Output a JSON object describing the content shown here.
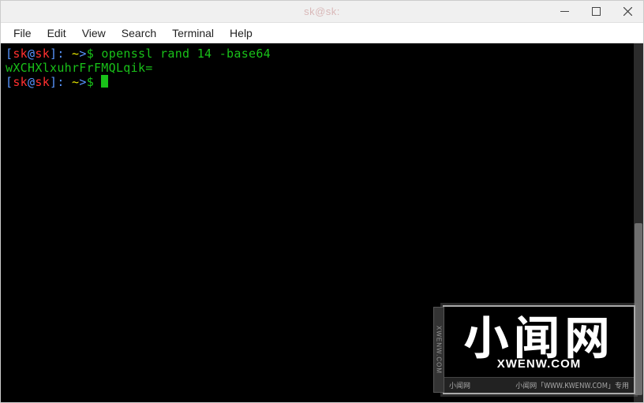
{
  "window": {
    "title": "sk@sk:"
  },
  "menubar": {
    "items": [
      "File",
      "Edit",
      "View",
      "Search",
      "Terminal",
      "Help"
    ]
  },
  "terminal": {
    "lines": [
      {
        "prompt": {
          "open": "[",
          "user": "sk",
          "at": "@",
          "host": "sk",
          "close": "]",
          "colon": ": ",
          "path": "~",
          "arrow": ">",
          "dollar": "$ "
        },
        "command": "openssl rand 14 -base64"
      },
      {
        "output": "wXCHXlxuhrFrFMQLqik="
      },
      {
        "prompt": {
          "open": "[",
          "user": "sk",
          "at": "@",
          "host": "sk",
          "close": "]",
          "colon": ": ",
          "path": "~",
          "arrow": ">",
          "dollar": "$ "
        },
        "cursor": true
      }
    ]
  },
  "watermark": {
    "chars": "小闻网",
    "url": "XWENW.COM",
    "side": "XWENW.COM",
    "footer_left": "小闻网",
    "footer_right": "小闻网「WWW.KWENW.COM」专用"
  }
}
